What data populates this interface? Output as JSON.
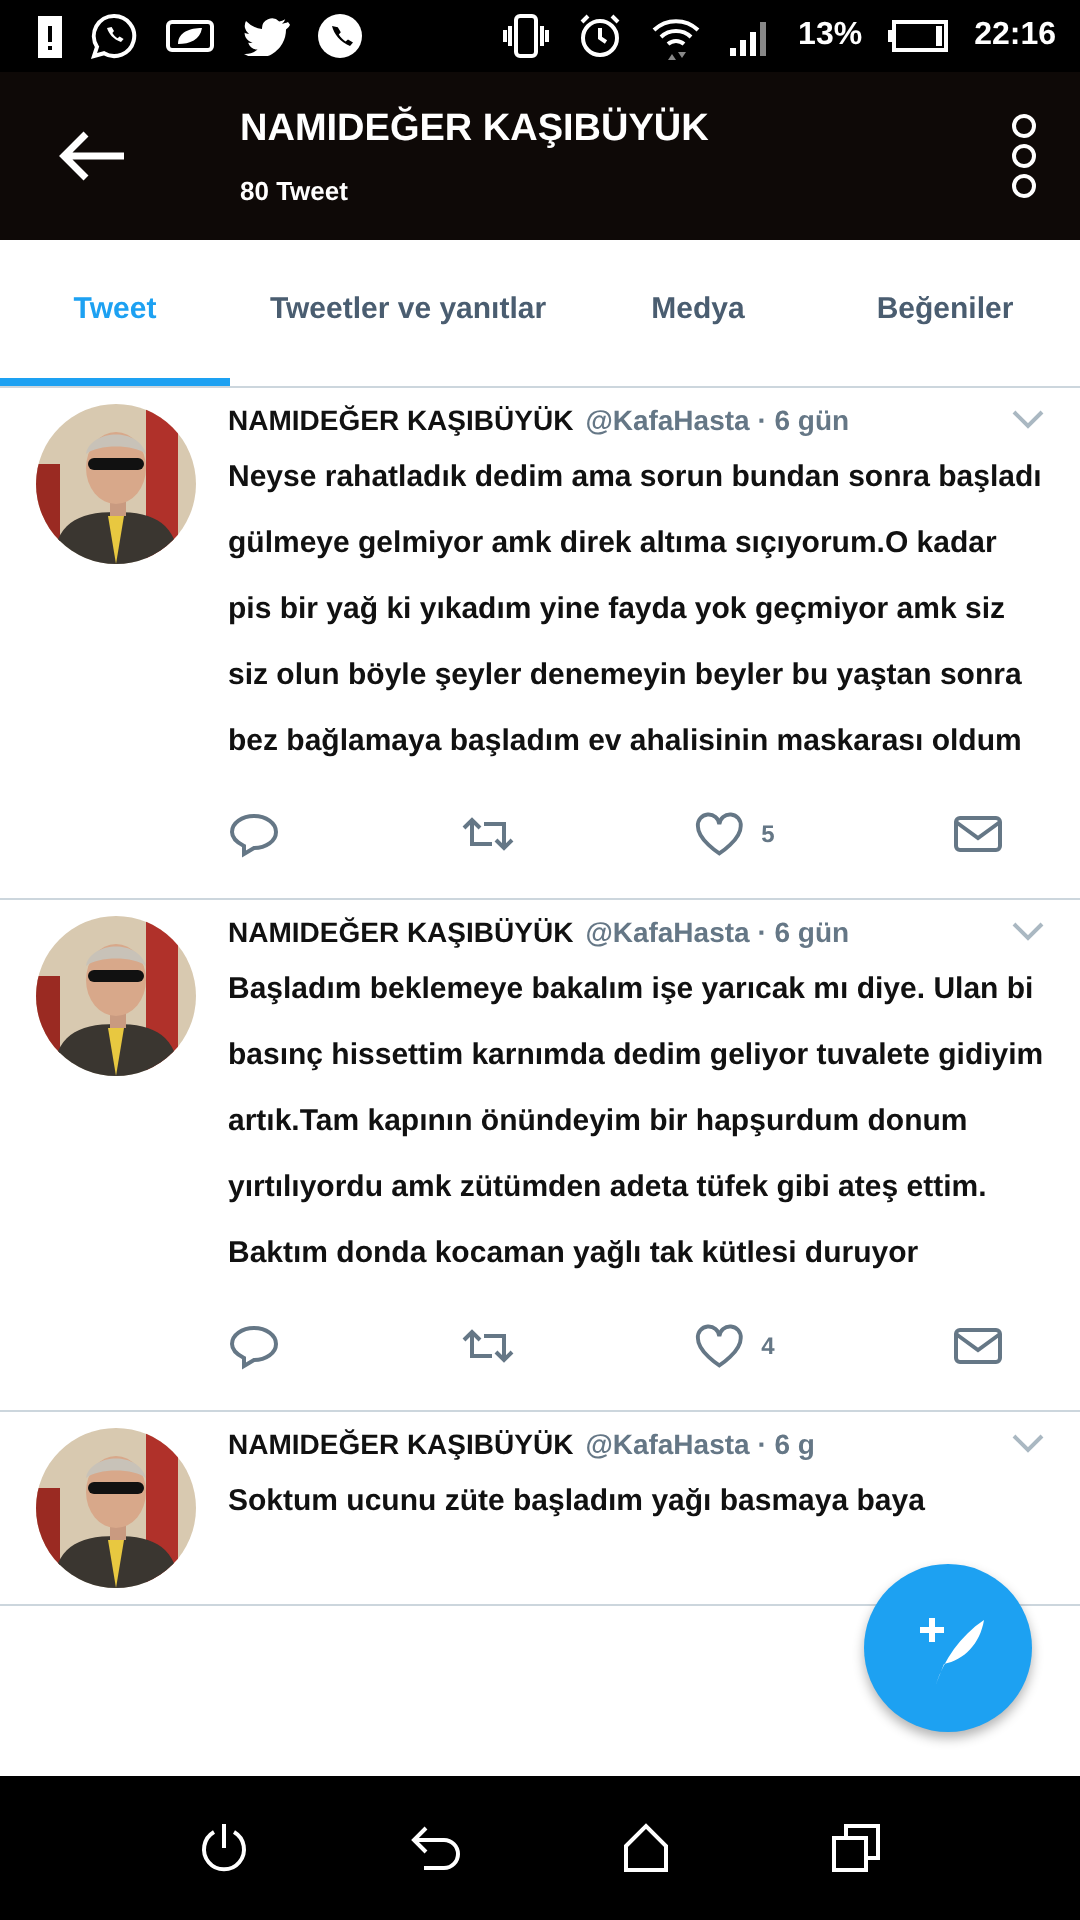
{
  "status_bar": {
    "battery_percent": "13%",
    "time": "22:16"
  },
  "header": {
    "title": "NAMIDEĞER KAŞIBÜYÜK",
    "subtitle": "80 Tweet"
  },
  "tabs": [
    {
      "label": "Tweet",
      "selected": true
    },
    {
      "label": "Tweetler ve yanıtlar",
      "selected": false
    },
    {
      "label": "Medya",
      "selected": false
    },
    {
      "label": "Beğeniler",
      "selected": false
    }
  ],
  "tweets": [
    {
      "name": "NAMIDEĞER KAŞIBÜYÜK",
      "meta": "@KafaHasta · 6 gün",
      "text": "Neyse rahatladık dedim ama sorun bundan sonra başladı gülmeye gelmiyor amk direk altıma sıçıyorum.O kadar pis bir yağ ki yıkadım yine fayda yok geçmiyor amk siz siz olun böyle şeyler denemeyin beyler bu yaştan sonra bez bağlamaya başladım ev ahalisinin maskarası oldum",
      "likes": "5"
    },
    {
      "name": "NAMIDEĞER KAŞIBÜYÜK",
      "meta": "@KafaHasta · 6 gün",
      "text": "Başladım beklemeye bakalım işe yarıcak mı diye. Ulan bi basınç hissettim karnımda dedim geliyor tuvalete gidiyim artık.Tam kapının önündeyim bir hapşurdum donum yırtılıyordu amk zütümden adeta tüfek gibi ateş ettim. Baktım donda kocaman yağlı tak kütlesi duruyor",
      "likes": "4"
    },
    {
      "name": "NAMIDEĞER KAŞIBÜYÜK",
      "meta": "@KafaHasta · 6 g",
      "text": "Soktum ucunu züte başladım yağı basmaya baya"
    }
  ]
}
